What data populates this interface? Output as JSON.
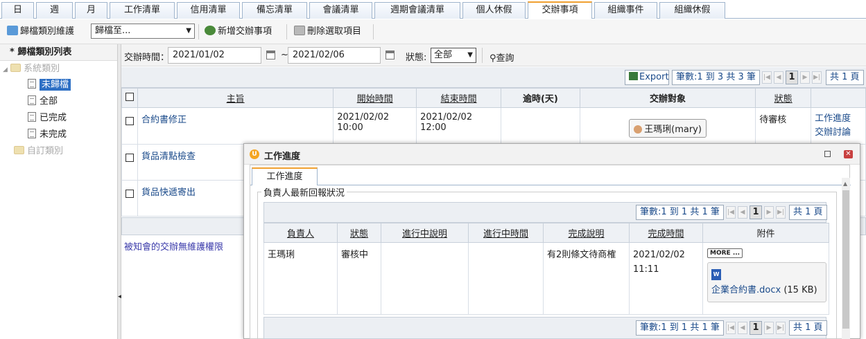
{
  "tabs": [
    "日",
    "週",
    "月",
    "工作清單",
    "信用清單",
    "備忘清單",
    "會議清單",
    "週期會議清單",
    "個人休假",
    "交辦事項",
    "組織事件",
    "組織休假"
  ],
  "active_tab": "交辦事項",
  "toolbar": {
    "maintain_label": "歸檔類別維護",
    "archive_select": "歸檔至...",
    "new_label": "新增交辦事項",
    "delete_label": "刪除選取項目"
  },
  "sidebar": {
    "title": "* 歸檔類別列表",
    "system_group": "系統類別",
    "items": [
      "未歸檔",
      "全部",
      "已完成",
      "未完成"
    ],
    "selected": "未歸檔",
    "custom_group": "自訂類別"
  },
  "filter": {
    "time_label": "交辦時間：",
    "start_date": "2021/01/02",
    "tilde": "~",
    "end_date": "2021/02/06",
    "status_label": "狀態:",
    "status_value": "全部",
    "query_label": "查詢"
  },
  "pager": {
    "export_label": "Export",
    "summary": "筆數:1 到 3 共 3 筆",
    "current_page": "1",
    "total_pages": "共 1 頁"
  },
  "table": {
    "headers": [
      "主旨",
      "開始時間",
      "結束時間",
      "逾時(天)",
      "交辦對象",
      "狀態"
    ],
    "rows": [
      {
        "subject": "合約書修正",
        "start": "2021/02/02 10:00",
        "end": "2021/02/02 12:00",
        "overdue": "",
        "assignee": "王瑪琍(mary)",
        "status": "待審核",
        "link1": "工作進度",
        "link2": "交辦討論"
      },
      {
        "subject": "貨品清點檢查"
      },
      {
        "subject": "貨品快遞寄出"
      }
    ],
    "notice": "被知會的交辦無維護權限"
  },
  "dialog": {
    "title": "工作進度",
    "tab": "工作進度",
    "legend": "負責人最新回報狀況",
    "pager_summary": "筆數:1 到 1 共 1 筆",
    "current_page": "1",
    "total_pages": "共 1 頁",
    "headers": [
      "負責人",
      "狀態",
      "進行中說明",
      "進行中時間",
      "完成說明",
      "完成時間",
      "附件"
    ],
    "row": {
      "owner": "王瑪琍",
      "status": "審核中",
      "progress_desc": "",
      "progress_time": "",
      "done_desc": "有2則條文待商榷",
      "done_time_date": "2021/02/02",
      "done_time_clock": "11:11",
      "more_label": "MORE ...",
      "file_name": "企業合約書.docx",
      "file_size": "(15 KB)"
    }
  },
  "colors": {
    "accent_tab": "#f0a030",
    "selected": "#2d6fc4",
    "link": "#1a4a8a"
  }
}
